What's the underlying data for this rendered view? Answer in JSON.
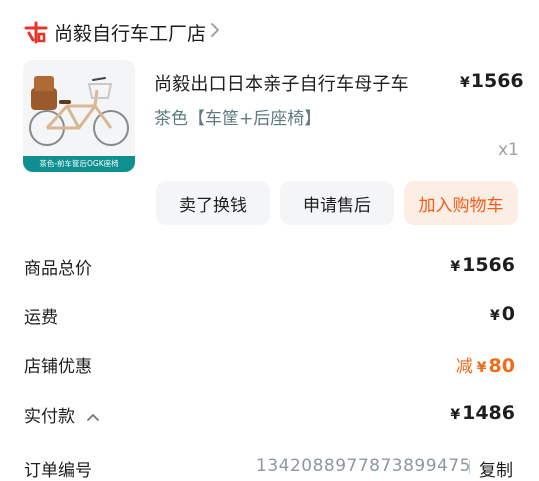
{
  "store": {
    "name": "尚毅自行车工厂店",
    "logo_icon": "tmall-store-icon",
    "chevron_icon": "chevron-right-icon",
    "accent": "#e8352b"
  },
  "product": {
    "image_icon": "bicycle-product-image",
    "image_banner": "茶色-前车筐后OGK座椅",
    "title": "尚毅出口日本亲子自行车母子车",
    "currency": "¥",
    "price": "1566",
    "variant": "茶色【车筐+后座椅】",
    "quantity": "x1"
  },
  "actions": {
    "sell": "卖了换钱",
    "after_sale": "申请售后",
    "add_cart": "加入购物车"
  },
  "summary": {
    "total_label": "商品总价",
    "total_value": "1566",
    "shipping_label": "运费",
    "shipping_value": "0",
    "discount_label": "店铺优惠",
    "discount_prefix": "减",
    "discount_value": "80",
    "paid_label": "实付款",
    "paid_value": "1486",
    "currency": "¥"
  },
  "order": {
    "label": "订单编号",
    "number": "1342088977873899475",
    "copy": "复制"
  },
  "colors": {
    "cart_text": "#f35c1a",
    "cart_bg": "#fdeee5",
    "discount": "#f06a1b",
    "variant_text": "#5f7a80"
  }
}
